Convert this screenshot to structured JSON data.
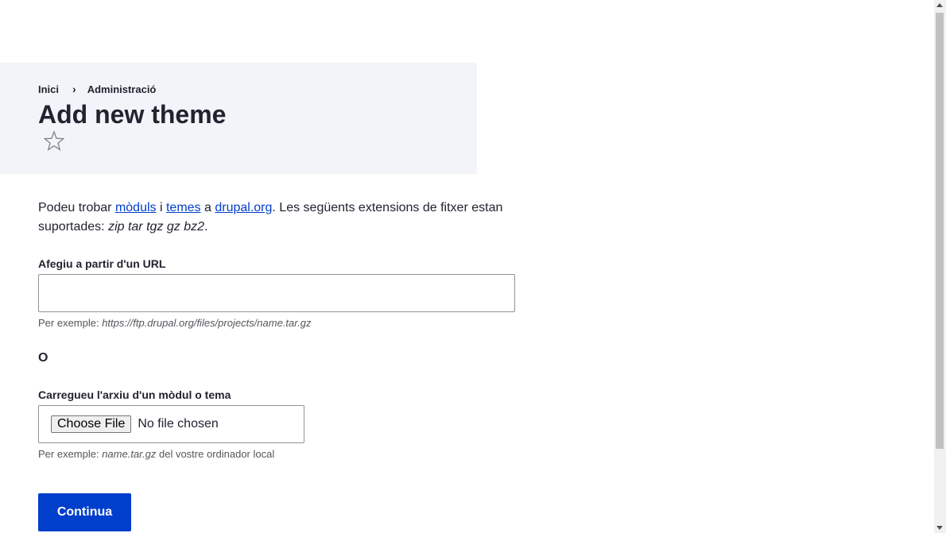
{
  "breadcrumb": {
    "items": [
      "Inici",
      "Administració"
    ],
    "separator": "›"
  },
  "header": {
    "title": "Add new theme"
  },
  "intro": {
    "prefix": "Podeu trobar ",
    "link_modules": "mòduls",
    "between1": " i ",
    "link_themes": "temes",
    "between2": " a ",
    "link_drupal": "drupal.org",
    "suffix": ". Les següents extensions de fitxer estan suportades: ",
    "extensions": "zip tar tgz gz bz2",
    "end": "."
  },
  "url_field": {
    "label": "Afegiu a partir d'un URL",
    "value": "",
    "description_prefix": "Per exemple: ",
    "description_example": "https://ftp.drupal.org/files/projects/name.tar.gz"
  },
  "or_text": "O",
  "upload_field": {
    "label": "Carregueu l'arxiu d'un mòdul o tema",
    "button_label": "Choose File",
    "status": "No file chosen",
    "description_prefix": "Per exemple: ",
    "description_example": "name.tar.gz",
    "description_suffix": " del vostre ordinador local"
  },
  "submit": {
    "label": "Continua"
  },
  "colors": {
    "accent": "#003ecc",
    "header_bg": "#f3f4f9",
    "text": "#222330"
  },
  "icons": {
    "favorite": "star-outline-icon"
  }
}
